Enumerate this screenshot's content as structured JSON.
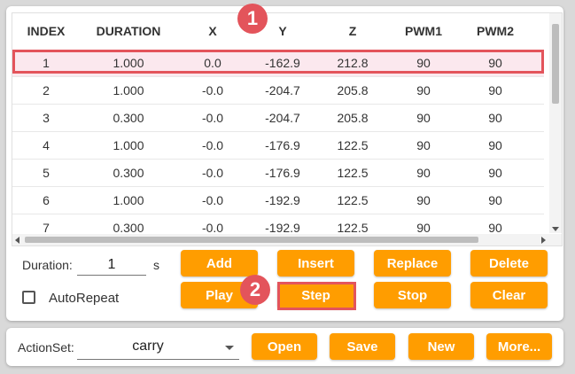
{
  "table": {
    "headers": [
      "INDEX",
      "DURATION",
      "X",
      "Y",
      "Z",
      "PWM1",
      "PWM2"
    ],
    "rows": [
      [
        "1",
        "1.000",
        "0.0",
        "-162.9",
        "212.8",
        "90",
        "90"
      ],
      [
        "2",
        "1.000",
        "-0.0",
        "-204.7",
        "205.8",
        "90",
        "90"
      ],
      [
        "3",
        "0.300",
        "-0.0",
        "-204.7",
        "205.8",
        "90",
        "90"
      ],
      [
        "4",
        "1.000",
        "-0.0",
        "-176.9",
        "122.5",
        "90",
        "90"
      ],
      [
        "5",
        "0.300",
        "-0.0",
        "-176.9",
        "122.5",
        "90",
        "90"
      ],
      [
        "6",
        "1.000",
        "-0.0",
        "-192.9",
        "122.5",
        "90",
        "90"
      ],
      [
        "7",
        "0.300",
        "-0.0",
        "-192.9",
        "122.5",
        "90",
        "90"
      ]
    ],
    "selected_row": 0
  },
  "controls": {
    "duration_label": "Duration:",
    "duration_value": "1",
    "duration_unit": "s",
    "autorepeat_label": "AutoRepeat",
    "autorepeat_checked": false,
    "buttons": {
      "add": "Add",
      "insert": "Insert",
      "replace": "Replace",
      "delete": "Delete",
      "play": "Play",
      "step": "Step",
      "stop": "Stop",
      "clear": "Clear"
    }
  },
  "actionset": {
    "label": "ActionSet:",
    "value": "carry",
    "buttons": {
      "open": "Open",
      "save": "Save",
      "new": "New",
      "more": "More..."
    }
  },
  "annotations": {
    "badge1": "1",
    "badge2": "2"
  },
  "colors": {
    "accent": "#ff9d00",
    "highlight": "#e3545b",
    "selected_row_bg": "#fbe8ee"
  }
}
